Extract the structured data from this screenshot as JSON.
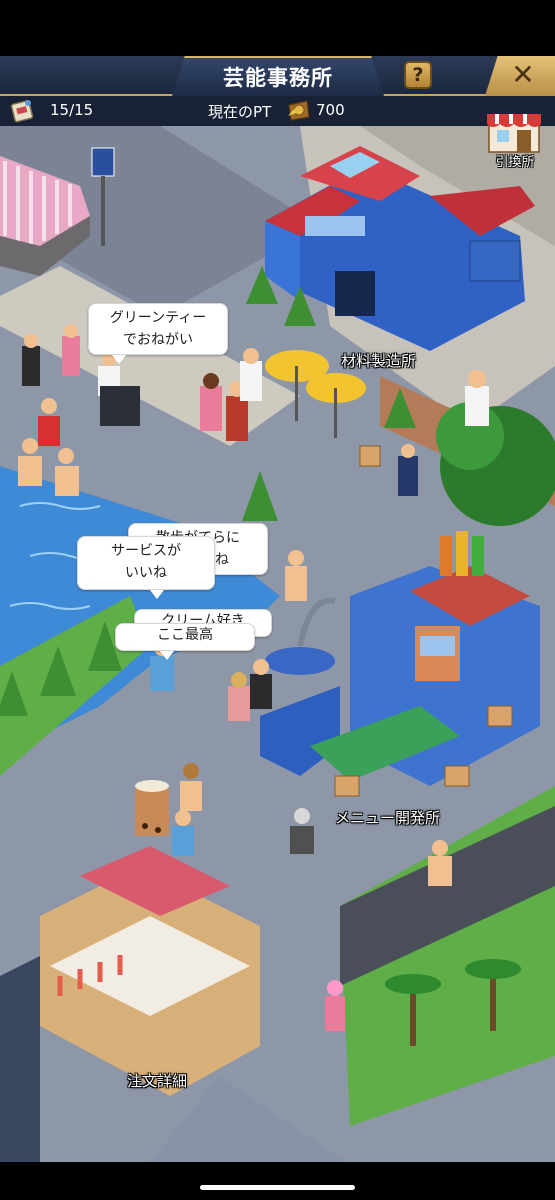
{
  "header": {
    "title": "芸能事務所",
    "help_label": "?",
    "close_label": "✕"
  },
  "status": {
    "tickets": "15/15",
    "points_label": "現在のPT",
    "points_value": "700"
  },
  "shop": {
    "exchange_label": "引換所"
  },
  "bubbles": {
    "green_tea": "グリーンティーでおねがい",
    "green_tea_line1": "グリーンティー",
    "green_tea_line2": "でおねがい",
    "walk_line1": "散歩がてらに",
    "walk_line2": "ね",
    "service_line1": "サービスが",
    "service_line2": "いいね",
    "cream": "クリーム好き",
    "best": "ここ最高"
  },
  "places": {
    "material_factory": "材料製造所",
    "menu_dev": "メニュー開発所",
    "order_details": "注文詳細"
  },
  "icons": {
    "ticket": "ticket-icon",
    "coin": "coin-icon",
    "help": "question-icon",
    "close": "close-icon",
    "shop": "shop-icon"
  },
  "colors": {
    "header_bg": "#1b2740",
    "gold": "#c9a55c",
    "water": "#3f8ad6",
    "grass": "#5fae48"
  }
}
